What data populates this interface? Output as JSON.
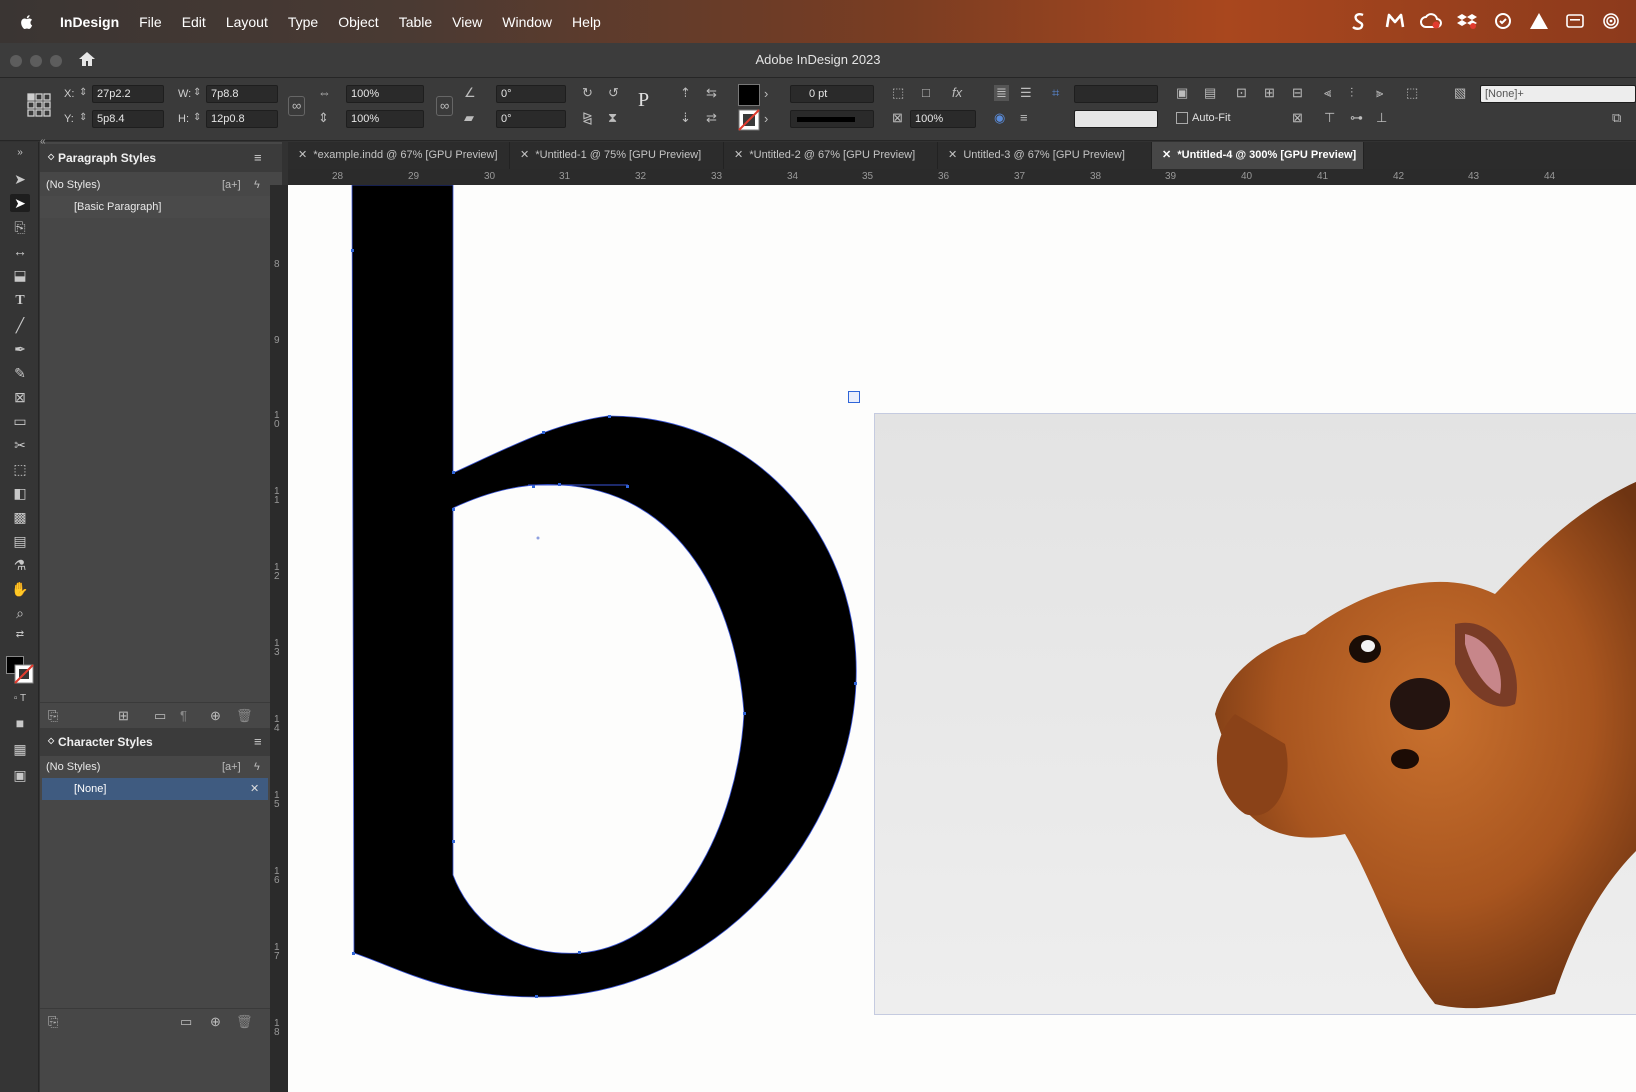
{
  "menubar": {
    "app_name": "InDesign",
    "items": [
      "File",
      "Edit",
      "Layout",
      "Type",
      "Object",
      "Table",
      "View",
      "Window",
      "Help"
    ],
    "status_icons": [
      "scrivener-icon",
      "malwarebytes-icon",
      "creative-cloud-icon",
      "dropbox-icon",
      "vpn-icon",
      "warning-icon",
      "menu-extra-icon",
      "airdrop-icon"
    ]
  },
  "window": {
    "title": "Adobe InDesign 2023"
  },
  "control_panel": {
    "x_label": "X:",
    "x_value": "27p2.2",
    "y_label": "Y:",
    "y_value": "5p8.4",
    "w_label": "W:",
    "w_value": "7p8.8",
    "h_label": "H:",
    "h_value": "12p0.8",
    "scale_x": "100%",
    "scale_y": "100%",
    "rotation": "0°",
    "shear": "0°",
    "stroke_weight": "0 pt",
    "opacity": "100%",
    "autofit_label": "Auto-Fit",
    "object_style": "[None]+"
  },
  "doc_tabs": [
    {
      "label": "*example.indd @ 67% [GPU Preview]",
      "active": false
    },
    {
      "label": "*Untitled-1 @ 75% [GPU Preview]",
      "active": false
    },
    {
      "label": "*Untitled-2 @ 67% [GPU Preview]",
      "active": false
    },
    {
      "label": "Untitled-3 @ 67% [GPU Preview]",
      "active": false
    },
    {
      "label": "*Untitled-4 @ 300% [GPU Preview]",
      "active": true
    }
  ],
  "paragraph_styles": {
    "title": "Paragraph Styles",
    "header_row": "(No Styles)",
    "items": [
      "[Basic Paragraph]"
    ]
  },
  "character_styles": {
    "title": "Character Styles",
    "header_row": "(No Styles)",
    "items": [
      "[None]"
    ],
    "selected": "[None]"
  },
  "new_style_badge": "[a+]",
  "ruler": {
    "h_ticks": [
      "28",
      "29",
      "30",
      "31",
      "32",
      "33",
      "34",
      "35",
      "36",
      "37",
      "38",
      "39",
      "40",
      "41",
      "42",
      "43",
      "44"
    ],
    "v_ticks": [
      "8",
      "9",
      "10",
      "11",
      "12",
      "13",
      "14",
      "15",
      "16",
      "17",
      "18"
    ]
  },
  "colors": {
    "accent": "#2f65d8",
    "selection": "#3f5b80",
    "canvas": "#fdfdfc"
  }
}
